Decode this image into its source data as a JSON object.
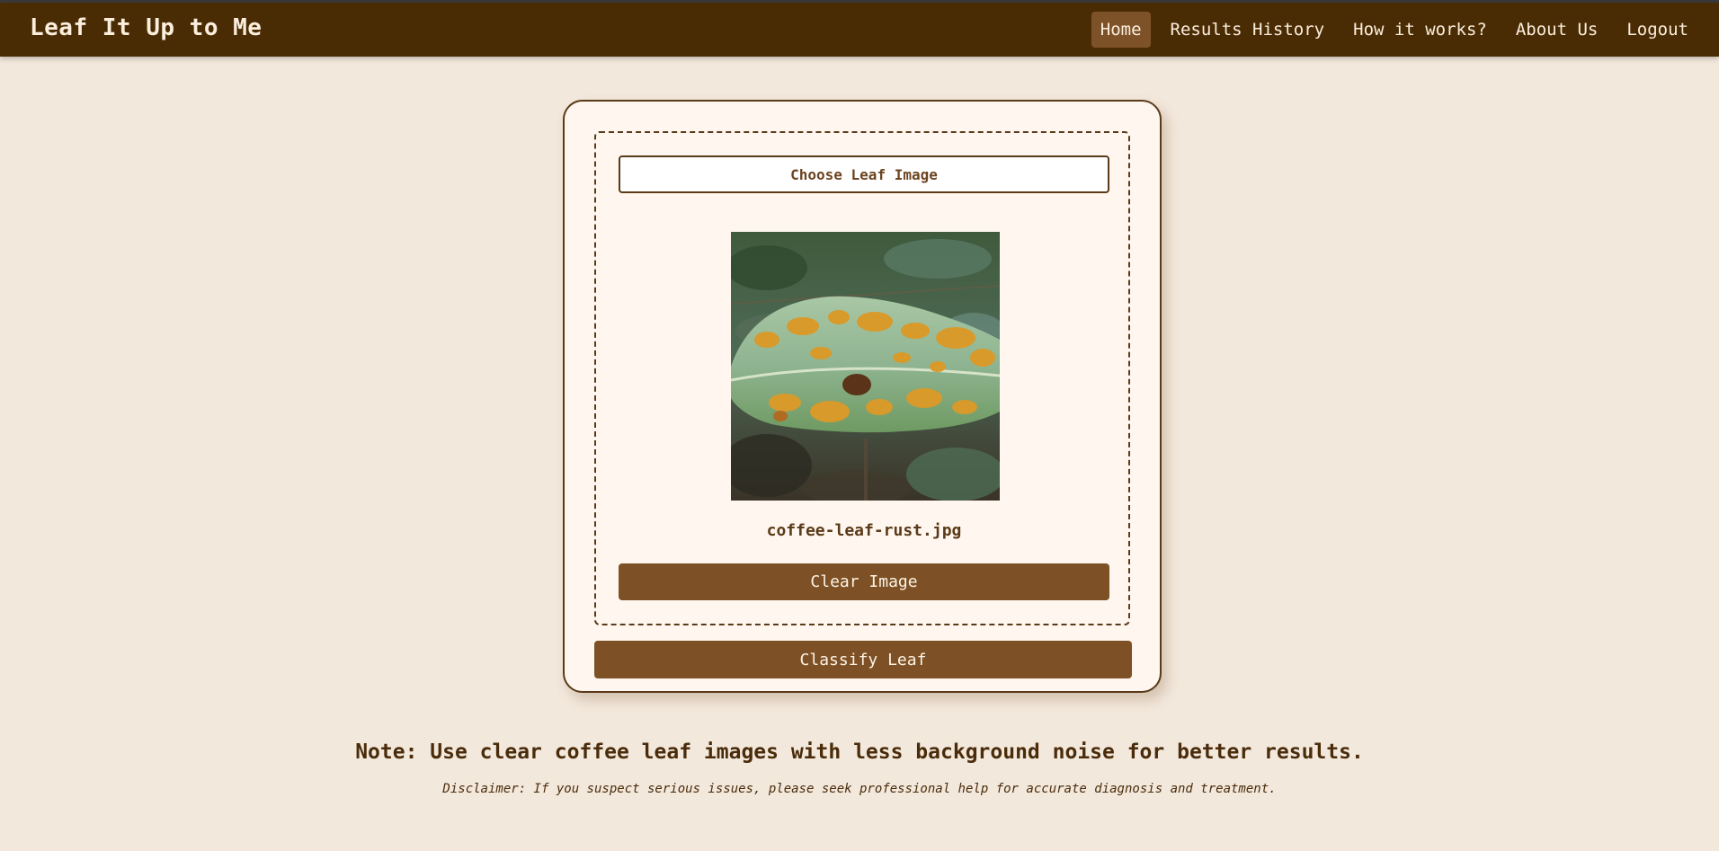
{
  "navbar": {
    "brand": "Leaf It Up to Me",
    "links": [
      {
        "label": "Home",
        "active": true
      },
      {
        "label": "Results History",
        "active": false
      },
      {
        "label": "How it works?",
        "active": false
      },
      {
        "label": "About Us",
        "active": false
      },
      {
        "label": "Logout",
        "active": false
      }
    ]
  },
  "upload": {
    "choose_label": "Choose Leaf Image",
    "preview_icon": "coffee-leaf-photo",
    "filename": "coffee-leaf-rust.jpg",
    "clear_label": "Clear Image"
  },
  "classify_label": "Classify Leaf",
  "note": "Note: Use clear coffee leaf images with less background noise for better results.",
  "disclaimer": "Disclaimer: If you suspect serious issues, please seek professional help for accurate diagnosis and treatment.",
  "colors": {
    "background": "#f3e8dc",
    "navbar": "#4a2c04",
    "accent": "#7d5125",
    "active_nav": "#7d5228"
  }
}
